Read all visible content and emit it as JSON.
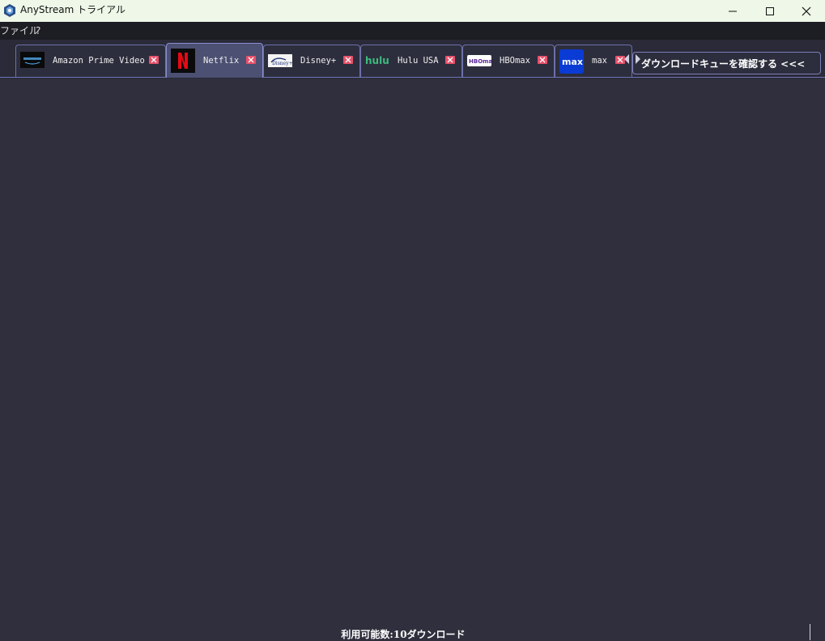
{
  "window": {
    "title": "AnyStream トライアル",
    "controls": [
      "minimize-icon",
      "maximize-icon",
      "close-icon"
    ]
  },
  "menu": {
    "items": [
      "ファイル",
      "?"
    ]
  },
  "tabs": [
    {
      "label": "Amazon Prime Video",
      "logo": "prime-video-logo",
      "active": false
    },
    {
      "label": "Netflix",
      "logo": "netflix-logo",
      "active": true
    },
    {
      "label": "Disney+",
      "logo": "disney-plus-logo",
      "active": false
    },
    {
      "label": "Hulu USA",
      "logo": "hulu-logo",
      "active": false
    },
    {
      "label": "HBOmax",
      "logo": "hbomax-logo",
      "active": false
    },
    {
      "label": "max",
      "logo": "max-logo",
      "active": false
    }
  ],
  "queue_button": {
    "label": "ダウンロードキューを確認する <<<"
  },
  "status": {
    "text": "利用可能数:10ダウンロード"
  },
  "colors": {
    "titlebar": "#eef7e8",
    "menubar": "#1d1d24",
    "background": "#2f2f3e",
    "tab_border": "#6c70a8",
    "active_tab": "#4c5072",
    "close_badge": "#e8506a"
  }
}
